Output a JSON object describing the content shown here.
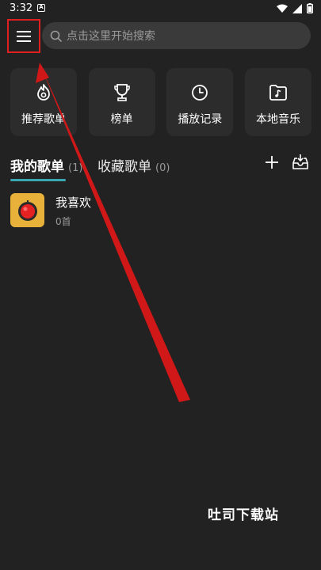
{
  "status_bar": {
    "time": "3:32",
    "app_icon": "A"
  },
  "menu": {
    "icon": "hamburger-menu-icon"
  },
  "search": {
    "placeholder": "点击这里开始搜索",
    "icon": "search-icon"
  },
  "quick_actions": [
    {
      "label": "推荐歌单",
      "icon": "flame-icon"
    },
    {
      "label": "榜单",
      "icon": "trophy-icon"
    },
    {
      "label": "播放记录",
      "icon": "clock-icon"
    },
    {
      "label": "本地音乐",
      "icon": "music-folder-icon"
    }
  ],
  "tabs": {
    "my_playlists": {
      "title": "我的歌单",
      "count": "(1)"
    },
    "favorite_playlists": {
      "title": "收藏歌单",
      "count": "(0)"
    }
  },
  "playlists": [
    {
      "name": "我喜欢",
      "count": "0首"
    }
  ],
  "watermark": "吐司下载站",
  "colors": {
    "background": "#222222",
    "tile": "#2c2c2c",
    "accent": "#3aa8b3",
    "annotation": "#e02020",
    "cover": "#e8b13a"
  }
}
